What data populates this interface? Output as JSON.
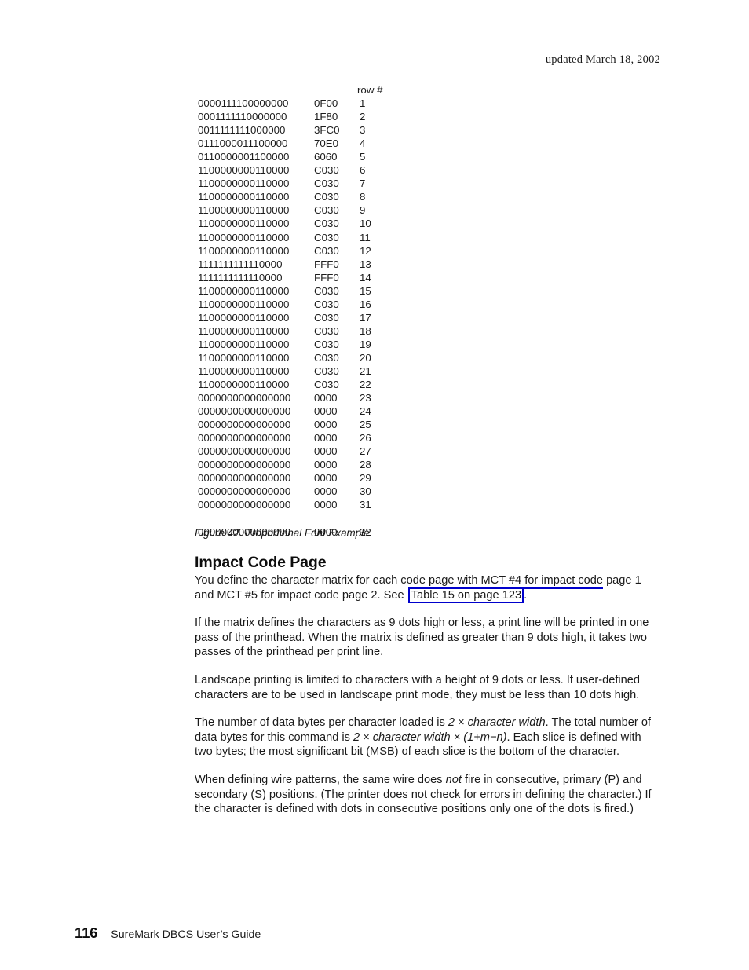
{
  "header": {
    "revision_note": "updated March 18, 2002"
  },
  "figure": {
    "columns": {
      "bits": "",
      "hex": "",
      "row_number": "row #"
    },
    "rows": [
      {
        "bits": "0000111100000000",
        "hex": "0F00",
        "row": "1"
      },
      {
        "bits": "0001111110000000",
        "hex": "1F80",
        "row": "2"
      },
      {
        "bits": "0011111111000000",
        "hex": "3FC0",
        "row": "3"
      },
      {
        "bits": "0111000011100000",
        "hex": "70E0",
        "row": "4"
      },
      {
        "bits": "0110000001100000",
        "hex": "6060",
        "row": "5"
      },
      {
        "bits": "1100000000110000",
        "hex": "C030",
        "row": "6"
      },
      {
        "bits": "1100000000110000",
        "hex": "C030",
        "row": "7"
      },
      {
        "bits": "1100000000110000",
        "hex": "C030",
        "row": "8"
      },
      {
        "bits": "1100000000110000",
        "hex": "C030",
        "row": "9"
      },
      {
        "bits": "1100000000110000",
        "hex": "C030",
        "row": "10"
      },
      {
        "bits": "1100000000110000",
        "hex": "C030",
        "row": "11"
      },
      {
        "bits": "1100000000110000",
        "hex": "C030",
        "row": "12"
      },
      {
        "bits": "1111111111110000",
        "hex": "FFF0",
        "row": "13"
      },
      {
        "bits": "1111111111110000",
        "hex": "FFF0",
        "row": "14"
      },
      {
        "bits": "1100000000110000",
        "hex": "C030",
        "row": "15"
      },
      {
        "bits": "1100000000110000",
        "hex": "C030",
        "row": "16"
      },
      {
        "bits": "1100000000110000",
        "hex": "C030",
        "row": "17"
      },
      {
        "bits": "1100000000110000",
        "hex": "C030",
        "row": "18"
      },
      {
        "bits": "1100000000110000",
        "hex": "C030",
        "row": "19"
      },
      {
        "bits": "1100000000110000",
        "hex": "C030",
        "row": "20"
      },
      {
        "bits": "1100000000110000",
        "hex": "C030",
        "row": "21"
      },
      {
        "bits": "1100000000110000",
        "hex": "C030",
        "row": "22"
      },
      {
        "bits": "0000000000000000",
        "hex": "0000",
        "row": "23"
      },
      {
        "bits": "0000000000000000",
        "hex": "0000",
        "row": "24"
      },
      {
        "bits": "0000000000000000",
        "hex": "0000",
        "row": "25"
      },
      {
        "bits": "0000000000000000",
        "hex": "0000",
        "row": "26"
      },
      {
        "bits": "0000000000000000",
        "hex": "0000",
        "row": "27"
      },
      {
        "bits": "0000000000000000",
        "hex": "0000",
        "row": "28"
      },
      {
        "bits": "0000000000000000",
        "hex": "0000",
        "row": "29"
      },
      {
        "bits": "0000000000000000",
        "hex": "0000",
        "row": "30"
      },
      {
        "bits": "0000000000000000",
        "hex": "0000",
        "row": "31"
      },
      {
        "bits": "0000000000000000",
        "hex": "0000",
        "row": "32",
        "gap_before": true
      }
    ],
    "caption": "Figure 42. Proportional Font Example"
  },
  "section": {
    "heading": "Impact Code Page",
    "paragraph_1": {
      "lead": "You define the character matrix for each code pa",
      "link_tail": "ge with MCT #4 for impact code",
      "middle": "page 1 and MCT #5 for impact code page 2. See ",
      "link_text": "Table 15 on page 123",
      "trailing": "."
    },
    "paragraph_2": "If the matrix defines the characters as 9 dots high or less, a print line will be printed in one pass of the printhead. When the matrix is defined as greater than 9 dots high, it takes two passes of the printhead per print line.",
    "paragraph_3": "Landscape printing is limited to characters with a height of 9 dots or less. If user-defined characters are to be used in landscape print mode, they must be less than 10 dots high.",
    "paragraph_4": {
      "part_1": "The number of data bytes per character loaded is ",
      "italic_1": "2 × character width",
      "part_2": ". The total number of data bytes for this command is ",
      "italic_2": "2 × character width × (1+m−n)",
      "part_3": ". Each slice is defined with two bytes; the most significant bit (MSB) of each slice is the bottom of the character."
    },
    "paragraph_5": {
      "part_1": "When defining wire patterns, the same wire does ",
      "italic_1": "not",
      "part_2": " fire in consecutive, primary (P) and secondary (S) positions. (The printer does not check for errors in defining the character.) If the character is defined with dots in consecutive positions only one of the dots is fired.)"
    }
  },
  "footer": {
    "page_number": "116",
    "book_title": "SureMark DBCS User’s Guide"
  },
  "colors": {
    "link": "#0000cc",
    "text": "#1a1a1a",
    "page_background": "#ffffff"
  }
}
